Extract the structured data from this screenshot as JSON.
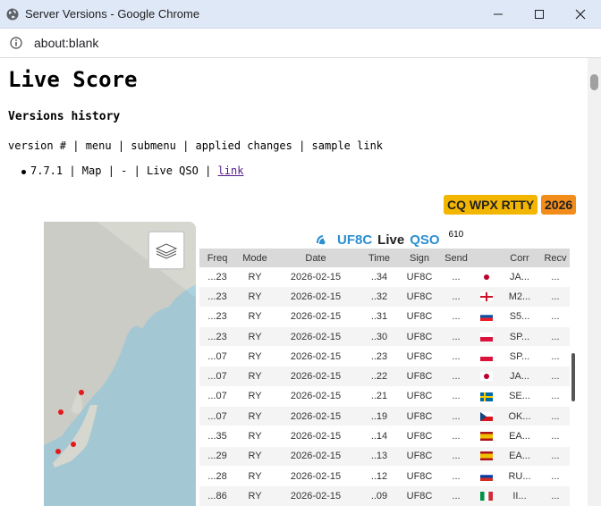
{
  "window": {
    "title": "Server Versions - Google Chrome"
  },
  "address_bar": {
    "url": "about:blank"
  },
  "page": {
    "title": "Live Score",
    "subtitle": "Versions history",
    "columns_line": "version # | menu | submenu | applied changes | sample link",
    "version_item": {
      "text": "7.7.1 | Map | - | Live QSO | ",
      "link_text": "link"
    }
  },
  "contest": {
    "name": "CQ WPX RTTY",
    "year": "2026",
    "name_color": "#f2b600",
    "year_color": "#f28c1b"
  },
  "widget": {
    "callsign": "UF8C",
    "live_label": "Live",
    "qso_label": "QSO",
    "qso_count": "610",
    "columns": [
      "Freq",
      "Mode",
      "Date",
      "Time",
      "Sign",
      "Send",
      "",
      "Corr",
      "Recv"
    ],
    "rows": [
      {
        "freq": "...23",
        "mode": "RY",
        "date": "2026-02-15",
        "time": "..34",
        "sign": "UF8C",
        "send": "...",
        "flag": "japan",
        "corr": "JA...",
        "recv": "..."
      },
      {
        "freq": "...23",
        "mode": "RY",
        "date": "2026-02-15",
        "time": "..32",
        "sign": "UF8C",
        "send": "...",
        "flag": "england",
        "corr": "M2...",
        "recv": "..."
      },
      {
        "freq": "...23",
        "mode": "RY",
        "date": "2026-02-15",
        "time": "..31",
        "sign": "UF8C",
        "send": "...",
        "flag": "slovenia",
        "corr": "S5...",
        "recv": "..."
      },
      {
        "freq": "...23",
        "mode": "RY",
        "date": "2026-02-15",
        "time": "..30",
        "sign": "UF8C",
        "send": "...",
        "flag": "poland",
        "corr": "SP...",
        "recv": "..."
      },
      {
        "freq": "...07",
        "mode": "RY",
        "date": "2026-02-15",
        "time": "..23",
        "sign": "UF8C",
        "send": "...",
        "flag": "poland",
        "corr": "SP...",
        "recv": "..."
      },
      {
        "freq": "...07",
        "mode": "RY",
        "date": "2026-02-15",
        "time": "..22",
        "sign": "UF8C",
        "send": "...",
        "flag": "japan",
        "corr": "JA...",
        "recv": "..."
      },
      {
        "freq": "...07",
        "mode": "RY",
        "date": "2026-02-15",
        "time": "..21",
        "sign": "UF8C",
        "send": "...",
        "flag": "sweden",
        "corr": "SE...",
        "recv": "..."
      },
      {
        "freq": "...07",
        "mode": "RY",
        "date": "2026-02-15",
        "time": "..19",
        "sign": "UF8C",
        "send": "...",
        "flag": "czech",
        "corr": "OK...",
        "recv": "..."
      },
      {
        "freq": "...35",
        "mode": "RY",
        "date": "2026-02-15",
        "time": "..14",
        "sign": "UF8C",
        "send": "...",
        "flag": "spain",
        "corr": "EA...",
        "recv": "..."
      },
      {
        "freq": "...29",
        "mode": "RY",
        "date": "2026-02-15",
        "time": "..13",
        "sign": "UF8C",
        "send": "...",
        "flag": "spain",
        "corr": "EA...",
        "recv": "..."
      },
      {
        "freq": "...28",
        "mode": "RY",
        "date": "2026-02-15",
        "time": "..12",
        "sign": "UF8C",
        "send": "...",
        "flag": "russia",
        "corr": "RU...",
        "recv": "..."
      },
      {
        "freq": "...86",
        "mode": "RY",
        "date": "2026-02-15",
        "time": "..09",
        "sign": "UF8C",
        "send": "...",
        "flag": "italy",
        "corr": "II...",
        "recv": "..."
      }
    ]
  },
  "icons": [
    "chrome-globe-icon",
    "minimize-icon",
    "maximize-icon",
    "close-icon",
    "info-icon",
    "layers-icon",
    "live-signal-icon"
  ]
}
